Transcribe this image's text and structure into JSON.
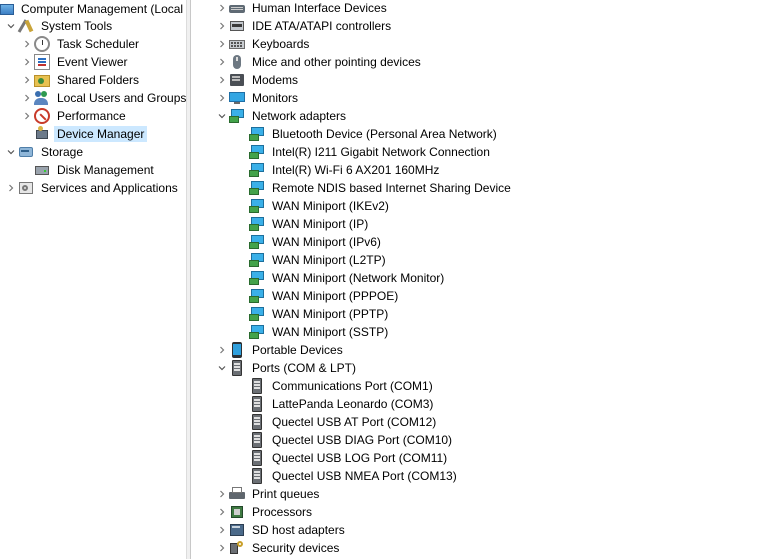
{
  "left_tree": [
    {
      "label": "Computer Management (Local",
      "icon": "computer-management-icon",
      "expander": "none"
    },
    {
      "label": "System Tools",
      "icon": "system-tools-icon",
      "expander": "expanded"
    },
    {
      "label": "Task Scheduler",
      "icon": "task-scheduler-icon",
      "expander": "collapsed"
    },
    {
      "label": "Event Viewer",
      "icon": "event-viewer-icon",
      "expander": "collapsed"
    },
    {
      "label": "Shared Folders",
      "icon": "shared-folders-icon",
      "expander": "collapsed"
    },
    {
      "label": "Local Users and Groups",
      "icon": "local-users-groups-icon",
      "expander": "collapsed"
    },
    {
      "label": "Performance",
      "icon": "performance-icon",
      "expander": "collapsed"
    },
    {
      "label": "Device Manager",
      "icon": "device-manager-icon",
      "expander": "none",
      "selected": true
    },
    {
      "label": "Storage",
      "icon": "storage-icon",
      "expander": "expanded"
    },
    {
      "label": "Disk Management",
      "icon": "disk-management-icon",
      "expander": "none"
    },
    {
      "label": "Services and Applications",
      "icon": "services-applications-icon",
      "expander": "collapsed"
    }
  ],
  "device_tree": [
    {
      "label": "Human Interface Devices",
      "icon": "hid-icon",
      "expander": "collapsed"
    },
    {
      "label": "IDE ATA/ATAPI controllers",
      "icon": "ide-controller-icon",
      "expander": "collapsed"
    },
    {
      "label": "Keyboards",
      "icon": "keyboard-icon",
      "expander": "collapsed"
    },
    {
      "label": "Mice and other pointing devices",
      "icon": "mouse-icon",
      "expander": "collapsed"
    },
    {
      "label": "Modems",
      "icon": "modem-icon",
      "expander": "collapsed"
    },
    {
      "label": "Monitors",
      "icon": "monitor-icon",
      "expander": "collapsed"
    },
    {
      "label": "Network adapters",
      "icon": "network-adapter-icon",
      "expander": "expanded",
      "children": [
        {
          "label": "Bluetooth Device (Personal Area Network)",
          "icon": "network-adapter-icon"
        },
        {
          "label": "Intel(R) I211 Gigabit Network Connection",
          "icon": "network-adapter-icon"
        },
        {
          "label": "Intel(R) Wi-Fi 6 AX201 160MHz",
          "icon": "network-adapter-icon"
        },
        {
          "label": "Remote NDIS based Internet Sharing Device",
          "icon": "network-adapter-icon"
        },
        {
          "label": "WAN Miniport (IKEv2)",
          "icon": "network-adapter-icon"
        },
        {
          "label": "WAN Miniport (IP)",
          "icon": "network-adapter-icon"
        },
        {
          "label": "WAN Miniport (IPv6)",
          "icon": "network-adapter-icon"
        },
        {
          "label": "WAN Miniport (L2TP)",
          "icon": "network-adapter-icon"
        },
        {
          "label": "WAN Miniport (Network Monitor)",
          "icon": "network-adapter-icon"
        },
        {
          "label": "WAN Miniport (PPPOE)",
          "icon": "network-adapter-icon"
        },
        {
          "label": "WAN Miniport (PPTP)",
          "icon": "network-adapter-icon"
        },
        {
          "label": "WAN Miniport (SSTP)",
          "icon": "network-adapter-icon"
        }
      ]
    },
    {
      "label": "Portable Devices",
      "icon": "portable-device-icon",
      "expander": "collapsed"
    },
    {
      "label": "Ports (COM & LPT)",
      "icon": "port-icon",
      "expander": "expanded",
      "children": [
        {
          "label": "Communications Port (COM1)",
          "icon": "port-icon"
        },
        {
          "label": "LattePanda Leonardo (COM3)",
          "icon": "port-icon"
        },
        {
          "label": "Quectel USB AT Port (COM12)",
          "icon": "port-icon"
        },
        {
          "label": "Quectel USB DIAG Port (COM10)",
          "icon": "port-icon"
        },
        {
          "label": "Quectel USB LOG Port (COM11)",
          "icon": "port-icon"
        },
        {
          "label": "Quectel USB NMEA Port (COM13)",
          "icon": "port-icon"
        }
      ]
    },
    {
      "label": "Print queues",
      "icon": "printer-icon",
      "expander": "collapsed"
    },
    {
      "label": "Processors",
      "icon": "processor-icon",
      "expander": "collapsed"
    },
    {
      "label": "SD host adapters",
      "icon": "sd-host-icon",
      "expander": "collapsed"
    },
    {
      "label": "Security devices",
      "icon": "security-device-icon",
      "expander": "collapsed"
    }
  ],
  "colors": {
    "selection": "#cce8ff",
    "splitter": "#f0f0f0"
  }
}
